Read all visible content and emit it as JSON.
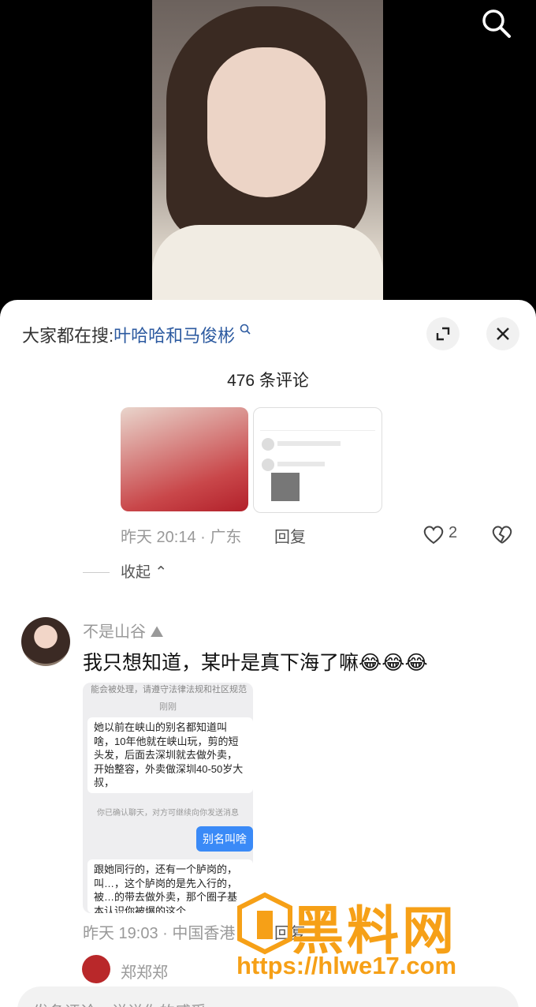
{
  "search_suggest": {
    "prefix": "大家都在搜:",
    "keyword": "叶哈哈和马俊彬"
  },
  "comment_count": "476 条评论",
  "reply1": {
    "time_location": "昨天 20:14 · 广东",
    "reply_label": "回复",
    "likes": "2"
  },
  "collapse_label": "收起",
  "comment2": {
    "username": "不是山谷",
    "text": "我只想知道，某叶是真下海了嘛",
    "screenshot": {
      "top_note": "能会被处理，请遵守法律法规和社区规范",
      "timestamp": "刚刚",
      "message1": "她以前在峡山的别名都知道叫啥，10年他就在峡山玩，剪的短头发，后面去深圳就去做外卖，开始整容，外卖做深圳40-50岁大叔，",
      "system_note": "你已确认聊天，对方可继续向你发送消息",
      "sent": "别名叫啥",
      "message2": "跟她同行的，还有一个胪岗的，叫…，这个胪岗的是先入行的，被…的带去做外卖，那个圈子基本认识你被爆的这个"
    },
    "time_location": "昨天 19:03 · 中国香港",
    "reply_label": "回复"
  },
  "comment3": {
    "username": "郑郑郑"
  },
  "input_placeholder": "发条评论，说说你的感受",
  "watermark": {
    "title": "黑料网",
    "url": "https://hlwe17.com"
  },
  "colors": {
    "keyword": "#2c5aa0",
    "watermark": "#f6a017"
  }
}
